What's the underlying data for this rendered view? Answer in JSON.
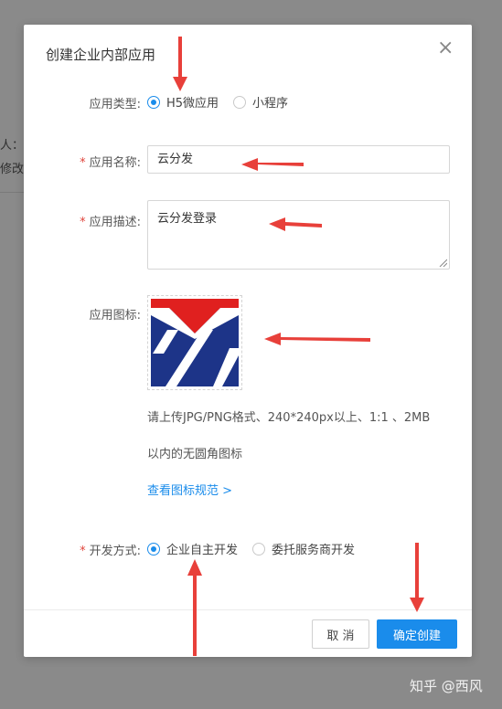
{
  "background": {
    "fragment_1": "人：小",
    "fragment_2": "修改："
  },
  "modal": {
    "title": "创建企业内部应用",
    "close_glyph": "×"
  },
  "form": {
    "app_type": {
      "label": "应用类型:",
      "options": [
        "H5微应用",
        "小程序"
      ],
      "selected": "H5微应用"
    },
    "app_name": {
      "required_mark": "*",
      "label": "应用名称:",
      "value": "云分发"
    },
    "app_desc": {
      "required_mark": "*",
      "label": "应用描述:",
      "value": "云分发登录"
    },
    "app_icon": {
      "label": "应用图标:",
      "hint_line_1": "请上传JPG/PNG格式、240*240px以上、1:1 、2MB",
      "hint_line_2": "以内的无圆角图标",
      "spec_link": "查看图标规范 >"
    },
    "dev_mode": {
      "required_mark": "*",
      "label": "开发方式:",
      "options": [
        "企业自主开发",
        "委托服务商开发"
      ],
      "selected": "企业自主开发"
    }
  },
  "footer": {
    "cancel_label": "取 消",
    "confirm_label": "确定创建"
  },
  "watermark": "知乎 @西风",
  "colors": {
    "primary": "#1a8ceb",
    "required": "#e0443b",
    "annotation_arrow": "#e8403a",
    "logo_red": "#e0201f",
    "logo_blue": "#1d3488"
  }
}
